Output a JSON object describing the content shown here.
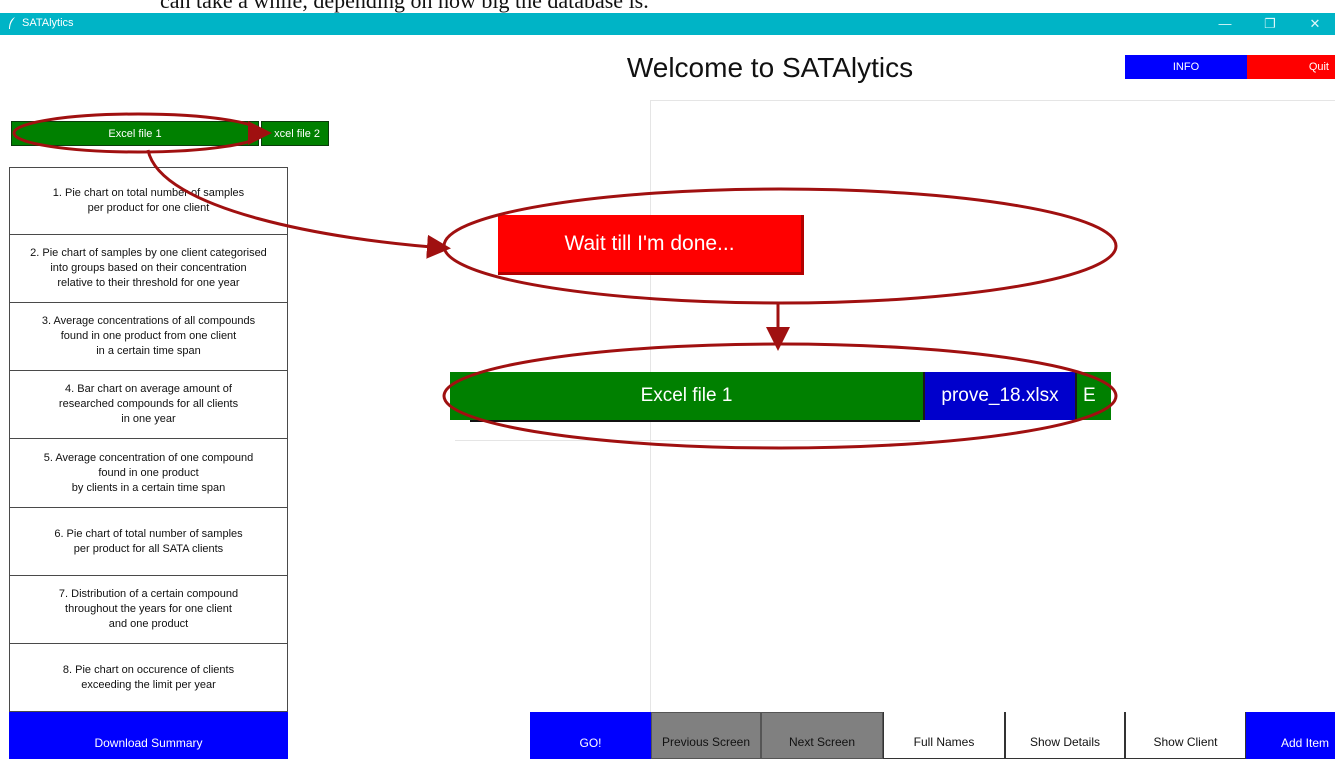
{
  "doc_caption": "can take a while, depending on how big the database is.",
  "window": {
    "title": "SATAlytics",
    "controls": {
      "minimize": "—",
      "restore": "❐",
      "close": "✕"
    }
  },
  "header": {
    "welcome": "Welcome to SATAlytics",
    "info_label": "INFO",
    "quit_label": "Quit"
  },
  "file_tabs": [
    {
      "label": "Excel file 1"
    },
    {
      "label": "xcel file 2"
    }
  ],
  "options": [
    {
      "label": "1. Pie chart on total number of samples\nper product for one client"
    },
    {
      "label": "2. Pie chart of samples by one client categorised\ninto groups based on their concentration\nrelative to their threshold for one year"
    },
    {
      "label": "3. Average concentrations of all compounds\nfound in one product from one client\nin a certain time span"
    },
    {
      "label": "4. Bar chart on average amount of\nresearched compounds for all clients\nin one year"
    },
    {
      "label": "5. Average concentration of one compound\nfound in one product\nby clients in a certain time span"
    },
    {
      "label": "6. Pie chart of total number of samples\nper product for all SATA clients"
    },
    {
      "label": "7. Distribution of a certain compound\nthroughout the years for one client\nand one product"
    },
    {
      "label": "8. Pie chart on occurence of clients\nexceeding the limit per year"
    }
  ],
  "download_label": "Download Summary",
  "bottom_buttons": {
    "go": "GO!",
    "previous": "Previous Screen",
    "next": "Next Screen",
    "full_names": "Full Names",
    "show_details": "Show Details",
    "show_client": "Show Client",
    "add_item": "Add Item"
  },
  "callouts": {
    "wait_label": "Wait till I'm done...",
    "zoom_tab_label": "Excel file 1",
    "zoom_file_label": "prove_18.xlsx",
    "zoom_next_label": "E"
  },
  "colors": {
    "titlebar": "#00b4c6",
    "green": "#008000",
    "blue": "#0000ff",
    "red": "#ff0000",
    "gray": "#808080",
    "annotation": "#a01010"
  }
}
